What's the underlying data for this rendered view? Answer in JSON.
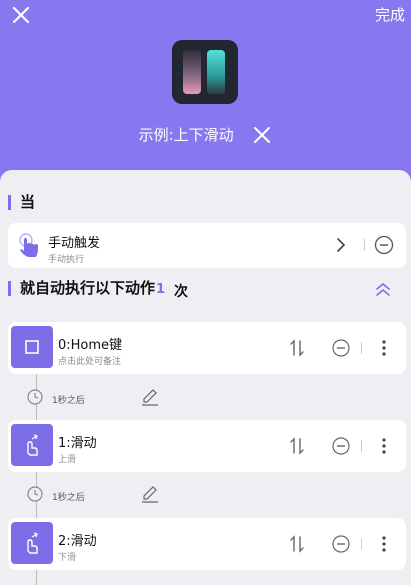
{
  "header": {
    "done_label": "完成",
    "title": "示例:上下滑动"
  },
  "trigger_section": {
    "title": "当",
    "trigger": {
      "title": "手动触发",
      "subtitle": "手动执行"
    }
  },
  "actions_section": {
    "title": "就自动执行以下动作",
    "count": "1",
    "count_unit": "次"
  },
  "actions": [
    {
      "title": "0:Home键",
      "subtitle": "点击此处可备注"
    },
    {
      "title": "1:滑动",
      "subtitle": "上滑"
    },
    {
      "title": "2:滑动",
      "subtitle": "下滑"
    }
  ],
  "delays": [
    {
      "label": "1秒之后"
    },
    {
      "label": "1秒之后"
    }
  ],
  "colors": {
    "accent": "#8878ef",
    "icon_bg": "#7b6ee7",
    "background": "#efeff3"
  },
  "icons": [
    "close-icon",
    "app-icon",
    "hand-tap-icon",
    "chevron-right-icon",
    "minus-circle-icon",
    "chevron-double-up-icon",
    "home-square-icon",
    "swipe-icon",
    "sort-icon",
    "more-vert-icon",
    "clock-icon",
    "pencil-icon"
  ]
}
